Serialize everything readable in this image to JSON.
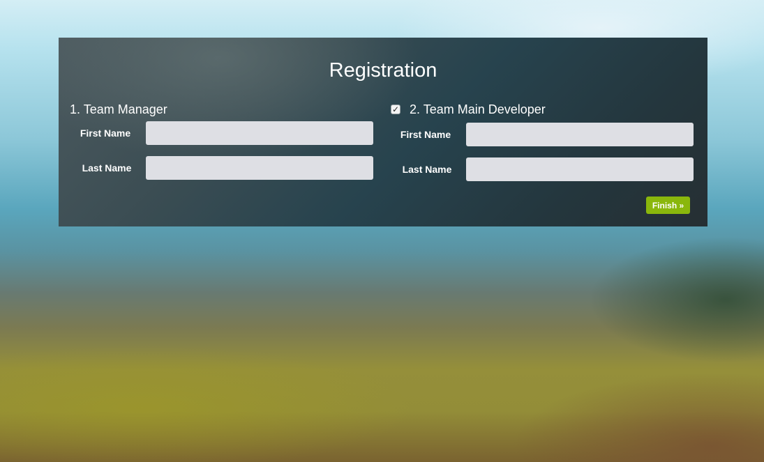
{
  "form": {
    "title": "Registration",
    "sections": [
      {
        "heading": "1. Team Manager",
        "first_name_label": "First Name",
        "first_name_value": "",
        "last_name_label": "Last Name",
        "last_name_value": ""
      },
      {
        "heading": "2. Team Main Developer",
        "checked": true,
        "checkbox_glyph": "✓",
        "first_name_label": "First Name",
        "first_name_value": "",
        "last_name_label": "Last Name",
        "last_name_value": ""
      }
    ],
    "finish_label": "Finish »"
  },
  "colors": {
    "panel": "#2a3c43",
    "accent": "#8ab70c",
    "field_bg": "#dedfe4",
    "text": "#ffffff"
  }
}
